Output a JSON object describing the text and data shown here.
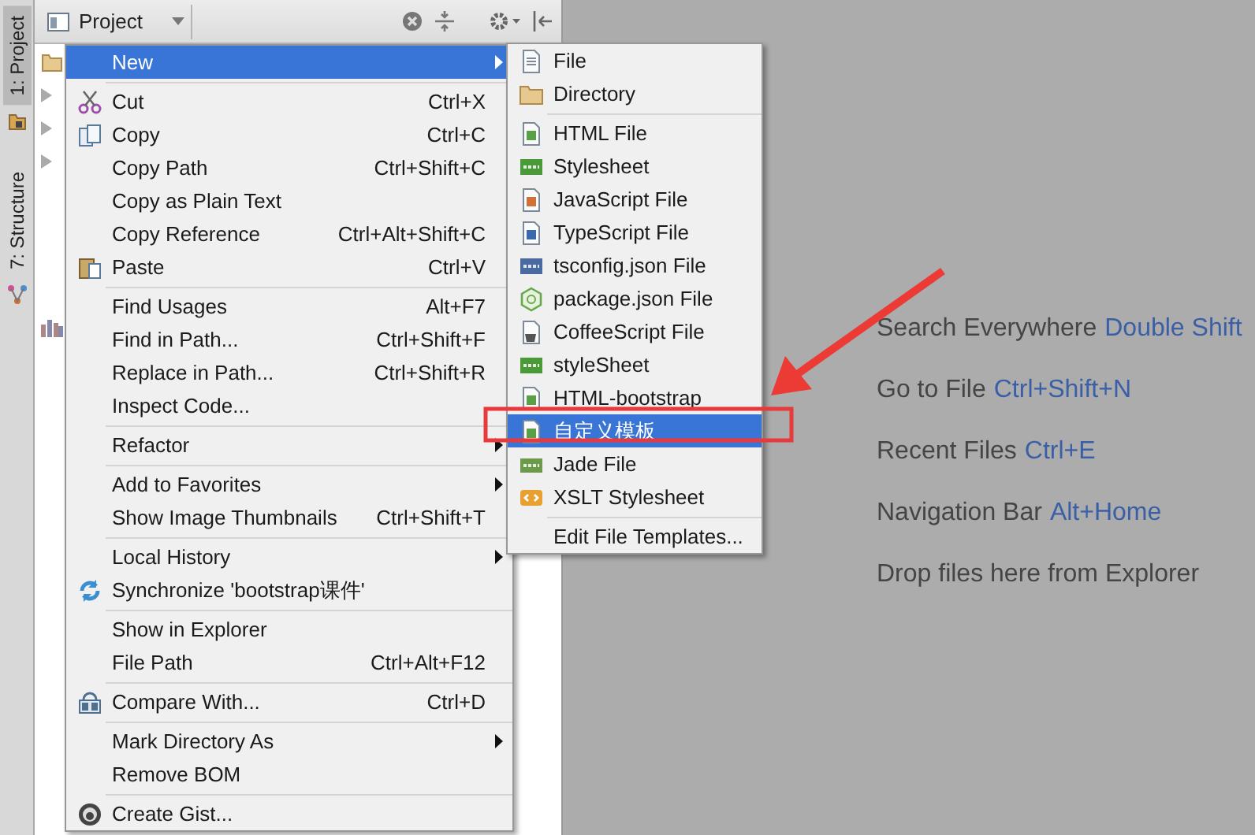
{
  "tool_strip": [
    {
      "label": "1: Project",
      "selected": true
    },
    {
      "label": "7: Structure",
      "selected": false
    }
  ],
  "project_panel": {
    "view_selector": "Project"
  },
  "context_menu": {
    "items": [
      {
        "kind": "item",
        "label": "New",
        "submenu": true,
        "selected": true
      },
      {
        "kind": "separator"
      },
      {
        "kind": "item",
        "label": "Cut",
        "shortcut": "Ctrl+X",
        "submenu": false,
        "selected": false
      },
      {
        "kind": "item",
        "label": "Copy",
        "shortcut": "Ctrl+C",
        "submenu": false,
        "selected": false
      },
      {
        "kind": "item",
        "label": "Copy Path",
        "shortcut": "Ctrl+Shift+C",
        "submenu": false,
        "selected": false
      },
      {
        "kind": "item",
        "label": "Copy as Plain Text",
        "submenu": false,
        "selected": false
      },
      {
        "kind": "item",
        "label": "Copy Reference",
        "shortcut": "Ctrl+Alt+Shift+C",
        "submenu": false,
        "selected": false
      },
      {
        "kind": "item",
        "label": "Paste",
        "shortcut": "Ctrl+V",
        "submenu": false,
        "selected": false
      },
      {
        "kind": "separator"
      },
      {
        "kind": "item",
        "label": "Find Usages",
        "shortcut": "Alt+F7",
        "submenu": false,
        "selected": false
      },
      {
        "kind": "item",
        "label": "Find in Path...",
        "shortcut": "Ctrl+Shift+F",
        "submenu": false,
        "selected": false
      },
      {
        "kind": "item",
        "label": "Replace in Path...",
        "shortcut": "Ctrl+Shift+R",
        "submenu": false,
        "selected": false
      },
      {
        "kind": "item",
        "label": "Inspect Code...",
        "submenu": false,
        "selected": false
      },
      {
        "kind": "separator"
      },
      {
        "kind": "item",
        "label": "Refactor",
        "submenu": true,
        "selected": false
      },
      {
        "kind": "separator"
      },
      {
        "kind": "item",
        "label": "Add to Favorites",
        "submenu": true,
        "selected": false
      },
      {
        "kind": "item",
        "label": "Show Image Thumbnails",
        "shortcut": "Ctrl+Shift+T",
        "submenu": false,
        "selected": false
      },
      {
        "kind": "separator"
      },
      {
        "kind": "item",
        "label": "Local History",
        "submenu": true,
        "selected": false
      },
      {
        "kind": "item",
        "label": "Synchronize 'bootstrap课件'",
        "submenu": false,
        "selected": false
      },
      {
        "kind": "separator"
      },
      {
        "kind": "item",
        "label": "Show in Explorer",
        "submenu": false,
        "selected": false
      },
      {
        "kind": "item",
        "label": "File Path",
        "shortcut": "Ctrl+Alt+F12",
        "submenu": false,
        "selected": false
      },
      {
        "kind": "separator"
      },
      {
        "kind": "item",
        "label": "Compare With...",
        "shortcut": "Ctrl+D",
        "submenu": false,
        "selected": false
      },
      {
        "kind": "separator"
      },
      {
        "kind": "item",
        "label": "Mark Directory As",
        "submenu": true,
        "selected": false
      },
      {
        "kind": "item",
        "label": "Remove BOM",
        "submenu": false,
        "selected": false
      },
      {
        "kind": "separator"
      },
      {
        "kind": "item",
        "label": "Create Gist...",
        "submenu": false,
        "selected": false
      }
    ]
  },
  "new_submenu": {
    "items": [
      {
        "kind": "item",
        "label": "File",
        "selected": false
      },
      {
        "kind": "item",
        "label": "Directory",
        "selected": false
      },
      {
        "kind": "separator"
      },
      {
        "kind": "item",
        "label": "HTML File",
        "selected": false
      },
      {
        "kind": "item",
        "label": "Stylesheet",
        "selected": false
      },
      {
        "kind": "item",
        "label": "JavaScript File",
        "selected": false
      },
      {
        "kind": "item",
        "label": "TypeScript File",
        "selected": false
      },
      {
        "kind": "item",
        "label": "tsconfig.json File",
        "selected": false
      },
      {
        "kind": "item",
        "label": "package.json File",
        "selected": false
      },
      {
        "kind": "item",
        "label": "CoffeeScript File",
        "selected": false
      },
      {
        "kind": "item",
        "label": "styleSheet",
        "selected": false
      },
      {
        "kind": "item",
        "label": "HTML-bootstrap",
        "selected": false
      },
      {
        "kind": "item",
        "label": "自定义模板",
        "selected": true
      },
      {
        "kind": "item",
        "label": "Jade File",
        "selected": false
      },
      {
        "kind": "item",
        "label": "XSLT Stylesheet",
        "selected": false
      },
      {
        "kind": "separator"
      },
      {
        "kind": "item",
        "label": "Edit File Templates...",
        "selected": false
      }
    ]
  },
  "editor_hints": [
    {
      "text": "Search Everywhere",
      "shortcut": "Double Shift"
    },
    {
      "text": "Go to File",
      "shortcut": "Ctrl+Shift+N"
    },
    {
      "text": "Recent Files",
      "shortcut": "Ctrl+E"
    },
    {
      "text": "Navigation Bar",
      "shortcut": "Alt+Home"
    },
    {
      "text": "Drop files here from Explorer"
    }
  ]
}
